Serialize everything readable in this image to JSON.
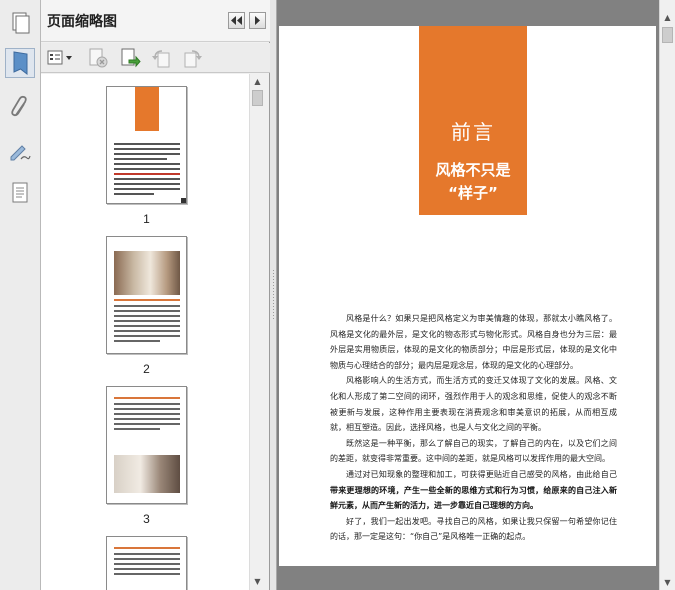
{
  "panel": {
    "title": "页面缩略图",
    "thumbnails": [
      {
        "label": "1"
      },
      {
        "label": "2"
      },
      {
        "label": "3"
      }
    ]
  },
  "document": {
    "banner_title": "前言",
    "banner_subtitle_line1": "风格不只是",
    "banner_subtitle_line2": "“样子”",
    "paragraphs": [
      "风格是什么？如果只是把风格定义为审美情趣的体现，那就太小瞧风格了。风格是文化的最外层，是文化的物态形式与物化形式。风格自身也分为三层：最外层是实用物质层，体现的是文化的物质部分；中层是形式层，体现的是文化中物质与心理结合的部分；最内层是观念层，体现的是文化的心理部分。",
      "风格影响人的生活方式，而生活方式的变迁又体现了文化的发展。风格、文化和人形成了第二空间的闭环，强烈作用于人的观念和思维，促使人的观念不断被更新与发展，这种作用主要表现在消费观念和审美意识的拓展，从而相互成就，相互塑造。因此，选择风格，也是人与文化之间的平衡。",
      "既然这是一种平衡，那么了解自己的现实，了解自己的内在，以及它们之间的差距，就变得非常重要。这中间的差距，就是风格可以发挥作用的最大空间。"
    ],
    "para4_normal": "通过对已知现象的整理和加工，可获得更贴近自己感受的风格，由此给自己",
    "para4_bold": "带来更理想的环境，产生一些全新的思维方式和行为习惯，给原来的自己注入新鲜元素，从而产生新的活力，进一步靠近自己理想的方向。",
    "para5": "好了，我们一起出发吧。寻找自己的风格，如果让我只保留一句希望你记住的话，那一定是这句：“你自己”是风格唯一正确的起点。"
  },
  "colors": {
    "accent_orange": "#e5782c",
    "viewer_background": "#818181"
  },
  "icons": {
    "rail": [
      "bookmark-icon",
      "paperclip-icon",
      "signature-icon",
      "document-layers-icon"
    ],
    "toolbar": [
      "options-menu-icon",
      "delete-page-icon",
      "insert-page-icon",
      "rotate-counterclockwise-icon",
      "rotate-clockwise-icon"
    ]
  }
}
